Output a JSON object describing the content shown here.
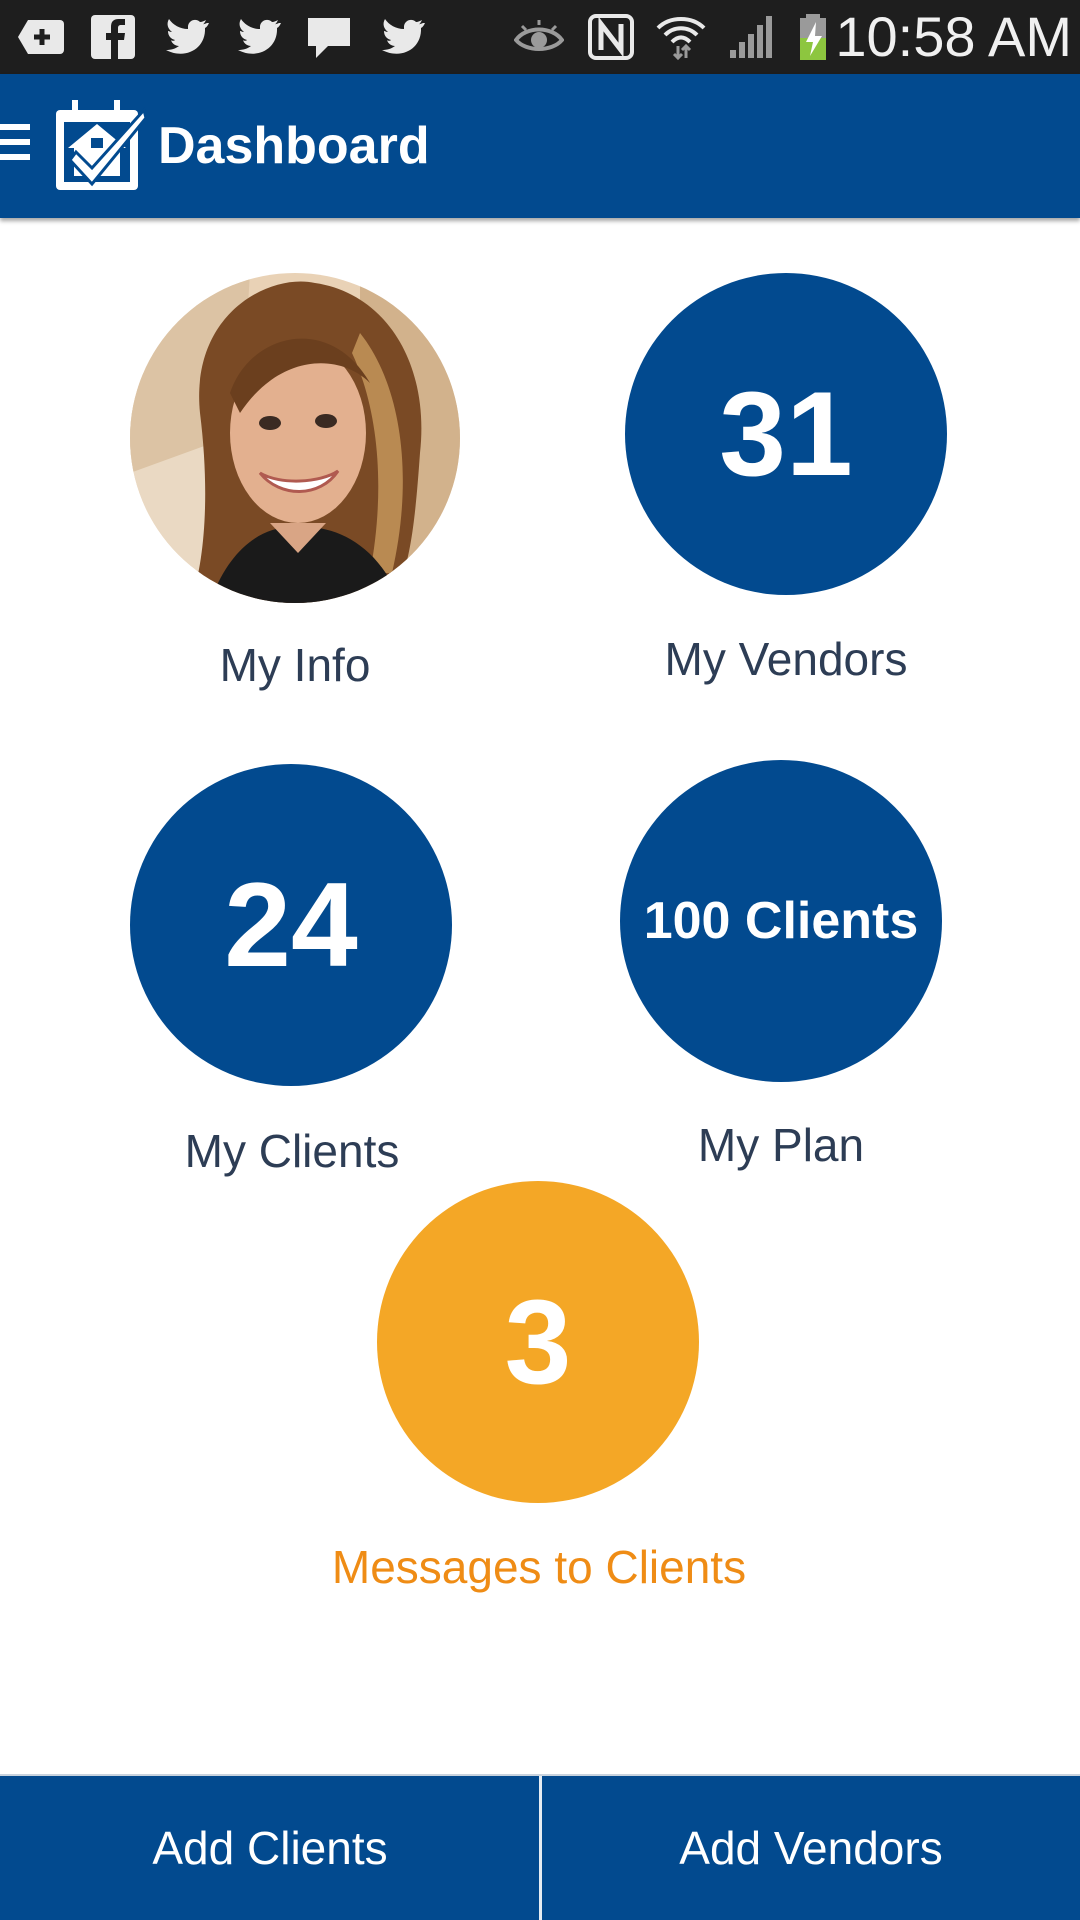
{
  "status_bar": {
    "time": "10:58 AM",
    "icons": [
      "add-notification-icon",
      "facebook-icon",
      "twitter-icon",
      "twitter-icon",
      "message-icon",
      "twitter-icon",
      "eye-icon",
      "nfc-icon",
      "wifi-icon",
      "signal-icon",
      "battery-charging-icon"
    ]
  },
  "app_bar": {
    "title": "Dashboard",
    "menu_icon": "hamburger-menu-icon",
    "logo_icon": "calendar-house-check-icon"
  },
  "tiles": {
    "my_info": {
      "label": "My Info"
    },
    "my_vendors": {
      "value": "31",
      "label": "My Vendors"
    },
    "my_clients": {
      "value": "24",
      "label": "My Clients"
    },
    "my_plan": {
      "value": "100 Clients",
      "label": "My Plan"
    },
    "messages": {
      "value": "3",
      "label": "Messages to Clients"
    }
  },
  "bottom_buttons": {
    "add_clients": "Add Clients",
    "add_vendors": "Add Vendors"
  },
  "colors": {
    "primary_blue": "#024a8f",
    "accent_orange": "#f4a726",
    "label_orange": "#ef8c15",
    "label_text": "#2d3d55"
  }
}
